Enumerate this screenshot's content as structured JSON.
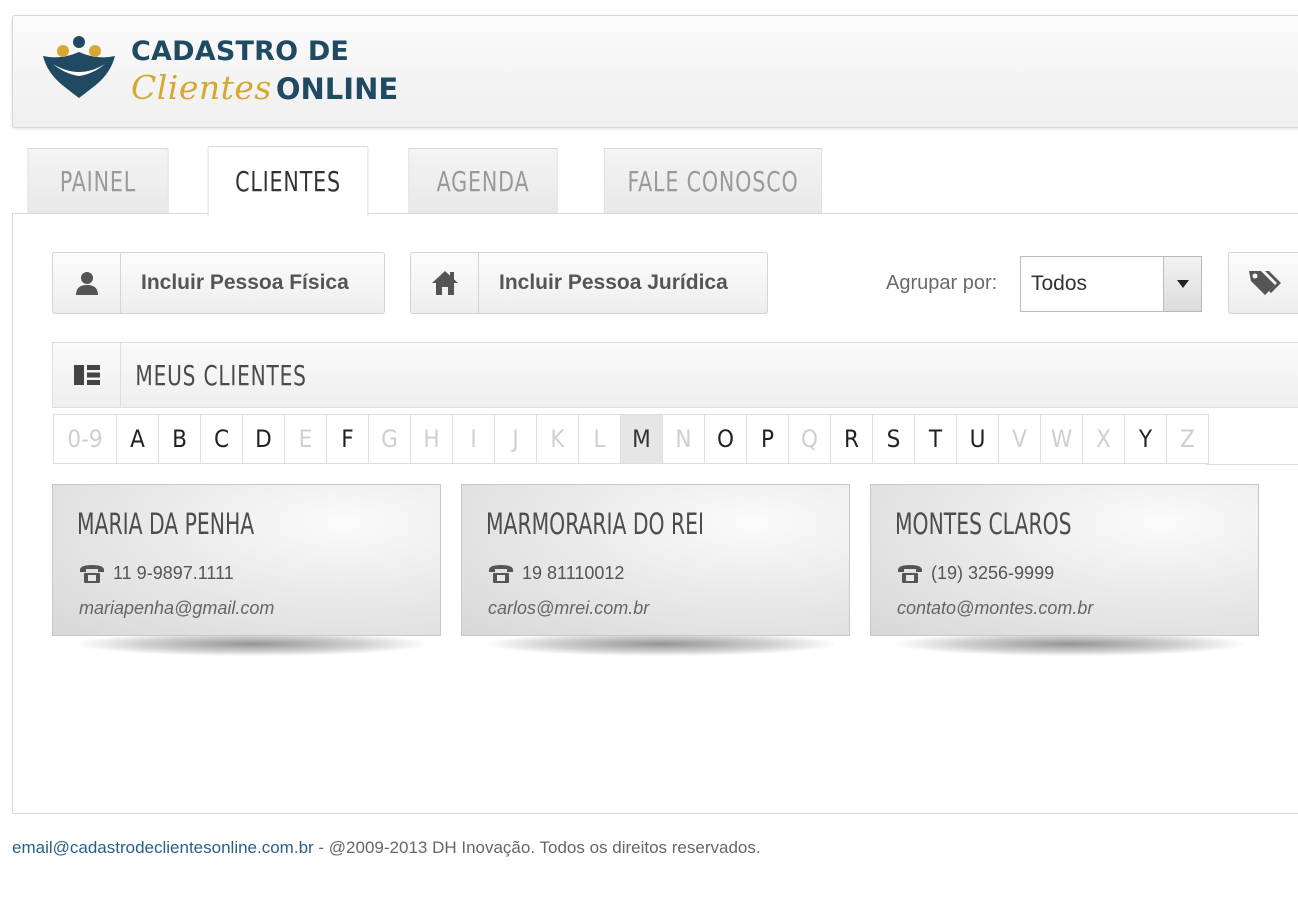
{
  "header": {
    "logo_line1": "CADASTRO DE",
    "logo_script": "Clientes",
    "logo_online": "ONLINE"
  },
  "tabs": [
    {
      "label": "PAINEL",
      "active": false
    },
    {
      "label": "CLIENTES",
      "active": true
    },
    {
      "label": "AGENDA",
      "active": false
    },
    {
      "label": "FALE CONOSCO",
      "active": false
    }
  ],
  "actions": {
    "pessoa_fisica": "Incluir Pessoa Física",
    "pessoa_juridica": "Incluir Pessoa Jurídica",
    "group_label": "Agrupar por:",
    "group_value": "Todos"
  },
  "section": {
    "title": "MEUS CLIENTES"
  },
  "alphabet": [
    {
      "label": "0-9",
      "state": "off"
    },
    {
      "label": "A",
      "state": "on"
    },
    {
      "label": "B",
      "state": "on"
    },
    {
      "label": "C",
      "state": "on"
    },
    {
      "label": "D",
      "state": "on"
    },
    {
      "label": "E",
      "state": "off"
    },
    {
      "label": "F",
      "state": "on"
    },
    {
      "label": "G",
      "state": "off"
    },
    {
      "label": "H",
      "state": "off"
    },
    {
      "label": "I",
      "state": "off"
    },
    {
      "label": "J",
      "state": "off"
    },
    {
      "label": "K",
      "state": "off"
    },
    {
      "label": "L",
      "state": "off"
    },
    {
      "label": "M",
      "state": "sel"
    },
    {
      "label": "N",
      "state": "off"
    },
    {
      "label": "O",
      "state": "on"
    },
    {
      "label": "P",
      "state": "on"
    },
    {
      "label": "Q",
      "state": "off"
    },
    {
      "label": "R",
      "state": "on"
    },
    {
      "label": "S",
      "state": "on"
    },
    {
      "label": "T",
      "state": "on"
    },
    {
      "label": "U",
      "state": "on"
    },
    {
      "label": "V",
      "state": "off"
    },
    {
      "label": "W",
      "state": "off"
    },
    {
      "label": "X",
      "state": "off"
    },
    {
      "label": "Y",
      "state": "on"
    },
    {
      "label": "Z",
      "state": "off"
    }
  ],
  "clients": [
    {
      "name": "MARIA DA PENHA",
      "phone": "11 9-9897.1111",
      "email": "mariapenha@gmail.com"
    },
    {
      "name": "MARMORARIA DO REI",
      "phone": "19 81110012",
      "email": "carlos@mrei.com.br"
    },
    {
      "name": "MONTES CLAROS",
      "phone": "(19) 3256-9999",
      "email": "contato@montes.com.br"
    }
  ],
  "footer": {
    "email": "email@cadastrodeclientesonline.com.br",
    "copyright": " - @2009-2013 DH Inovação. Todos os direitos reservados."
  },
  "colors": {
    "brand_dark": "#1f4a62",
    "brand_gold": "#d6a832",
    "link": "#2a5f88"
  },
  "icons": [
    "logo-mark",
    "person-icon",
    "house-icon",
    "dropdown-arrow-icon",
    "tags-icon",
    "list-view-icon",
    "phone-icon"
  ]
}
